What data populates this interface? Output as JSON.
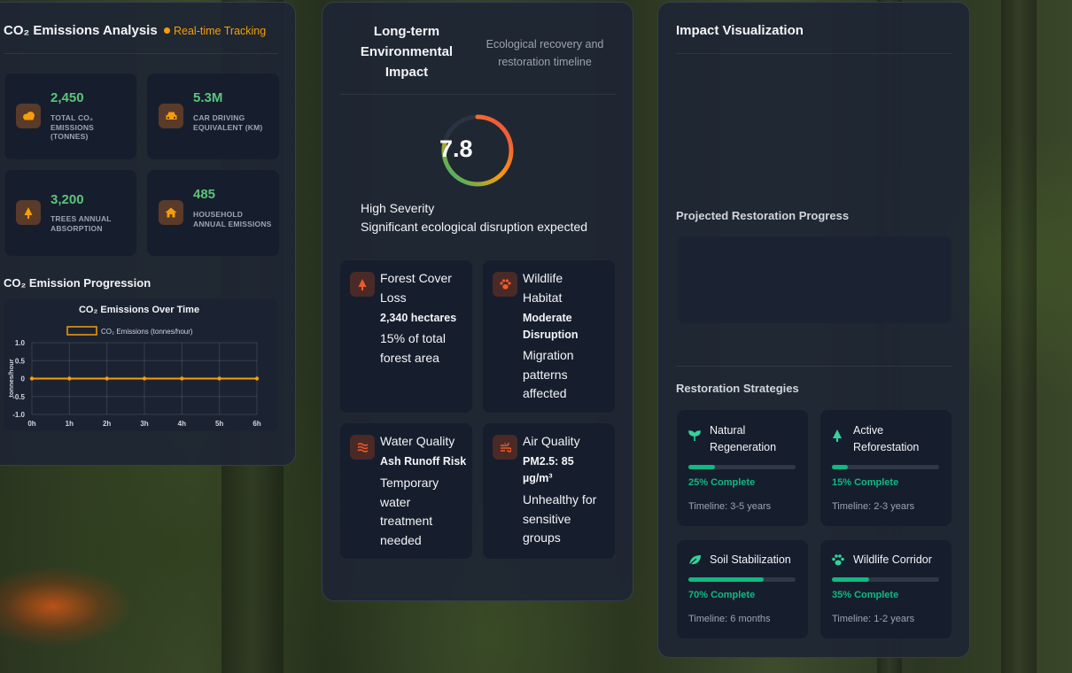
{
  "co2_panel": {
    "title": "CO₂ Emissions Analysis",
    "badge": "Real-time Tracking",
    "stats": [
      {
        "value": "2,450",
        "label": "TOTAL CO₂ EMISSIONS (TONNES)",
        "icon": "cloud-icon"
      },
      {
        "value": "5.3M",
        "label": "CAR DRIVING EQUIVALENT (KM)",
        "icon": "car-icon"
      },
      {
        "value": "3,200",
        "label": "TREES ANNUAL ABSORPTION",
        "icon": "tree-icon"
      },
      {
        "value": "485",
        "label": "HOUSEHOLD ANNUAL EMISSIONS",
        "icon": "home-icon"
      }
    ],
    "progression_title": "CO₂ Emission Progression"
  },
  "chart_data": {
    "type": "line",
    "title": "CO₂ Emissions Over Time",
    "ylabel": "tonnes/hour",
    "xlabel": "",
    "categories": [
      "0h",
      "1h",
      "2h",
      "3h",
      "4h",
      "5h",
      "6h"
    ],
    "series": [
      {
        "name": "CO₂ Emissions (tonnes/hour)",
        "values": [
          0,
          0,
          0,
          0,
          0,
          0,
          0
        ],
        "color": "#f59e0b"
      }
    ],
    "ylim": [
      -1.0,
      1.0
    ],
    "yticks": [
      "1.0",
      "0.5",
      "0",
      "-0.5",
      "-1.0"
    ],
    "grid": true,
    "legend": "top"
  },
  "impact_panel": {
    "title": "Long-term Environmental Impact",
    "subtitle": "Ecological recovery and restoration timeline",
    "score": "7.8",
    "score_fraction": 0.78,
    "severity": "High Severity",
    "severity_desc": "Significant ecological disruption expected",
    "cards": [
      {
        "icon": "tree-icon",
        "title": "Forest Cover Loss",
        "strong": "2,340 hectares",
        "text": "15% of total forest area"
      },
      {
        "icon": "paw-icon",
        "title": "Wildlife Habitat",
        "strong": "Moderate Disruption",
        "text": "Migration patterns affected"
      },
      {
        "icon": "water-icon",
        "title": "Water Quality",
        "strong": "Ash Runoff Risk",
        "text": "Temporary water treatment needed"
      },
      {
        "icon": "wind-icon",
        "title": "Air Quality",
        "strong": "PM2.5: 85 µg/m³",
        "text": "Unhealthy for sensitive groups"
      }
    ]
  },
  "viz_panel": {
    "title": "Impact Visualization",
    "progress_title": "Projected Restoration Progress",
    "strategies_title": "Restoration Strategies",
    "strategies": [
      {
        "icon": "seedling-icon",
        "name": "Natural Regeneration",
        "progress": 0.25,
        "pct_label": "25% Complete",
        "timeline": "Timeline: 3-5 years"
      },
      {
        "icon": "tree-icon",
        "name": "Active Reforestation",
        "progress": 0.15,
        "pct_label": "15% Complete",
        "timeline": "Timeline: 2-3 years"
      },
      {
        "icon": "leaf-icon",
        "name": "Soil Stabilization",
        "progress": 0.7,
        "pct_label": "70% Complete",
        "timeline": "Timeline: 6 months"
      },
      {
        "icon": "paw-icon",
        "name": "Wildlife Corridor",
        "progress": 0.35,
        "pct_label": "35% Complete",
        "timeline": "Timeline: 1-2 years"
      }
    ]
  }
}
